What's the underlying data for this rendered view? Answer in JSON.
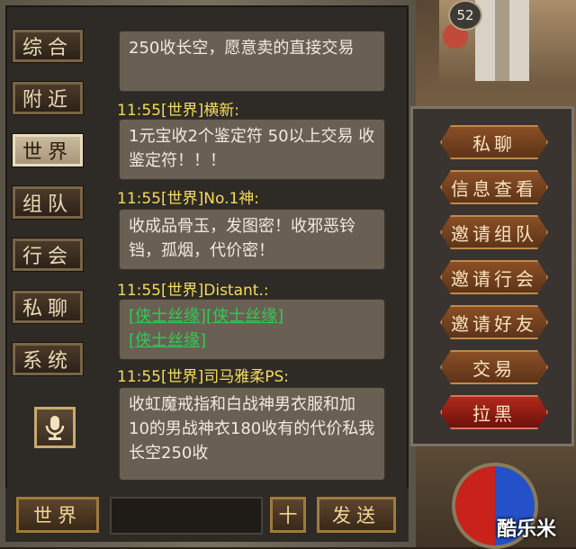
{
  "tabs": [
    "综合",
    "附近",
    "世界",
    "组队",
    "行会",
    "私聊",
    "系统"
  ],
  "active_tab": "世界",
  "messages": [
    {
      "sender": "",
      "text": "250收长空，愿意卖的直接交易"
    },
    {
      "sender": "11:55[世界]横新:",
      "text": "1元宝收2个鉴定符  50以上交易 收鉴定符！！！"
    },
    {
      "sender": "11:55[世界]No.1神:",
      "text": "收成品骨玉，发图密！收邪恶铃铛，孤烟，代价密！"
    },
    {
      "sender": "11:55[世界]Distant.:",
      "links": [
        "[侠士丝缘]",
        "[侠士丝缘]",
        "[侠士丝缘]"
      ]
    },
    {
      "sender": "11:55[世界]司马雅柔PS:",
      "text": "收虹魔戒指和白战神男衣服和加10的男战神衣180收有的代价私我长空250收"
    }
  ],
  "bottom": {
    "channel_button": "世界",
    "add_button": "十",
    "send_button": "发送"
  },
  "hud": {
    "level": "52"
  },
  "menu": [
    "私聊",
    "信息查看",
    "邀请组队",
    "邀请行会",
    "邀请好友",
    "交易",
    "拉黑"
  ],
  "watermark": "酷乐米"
}
